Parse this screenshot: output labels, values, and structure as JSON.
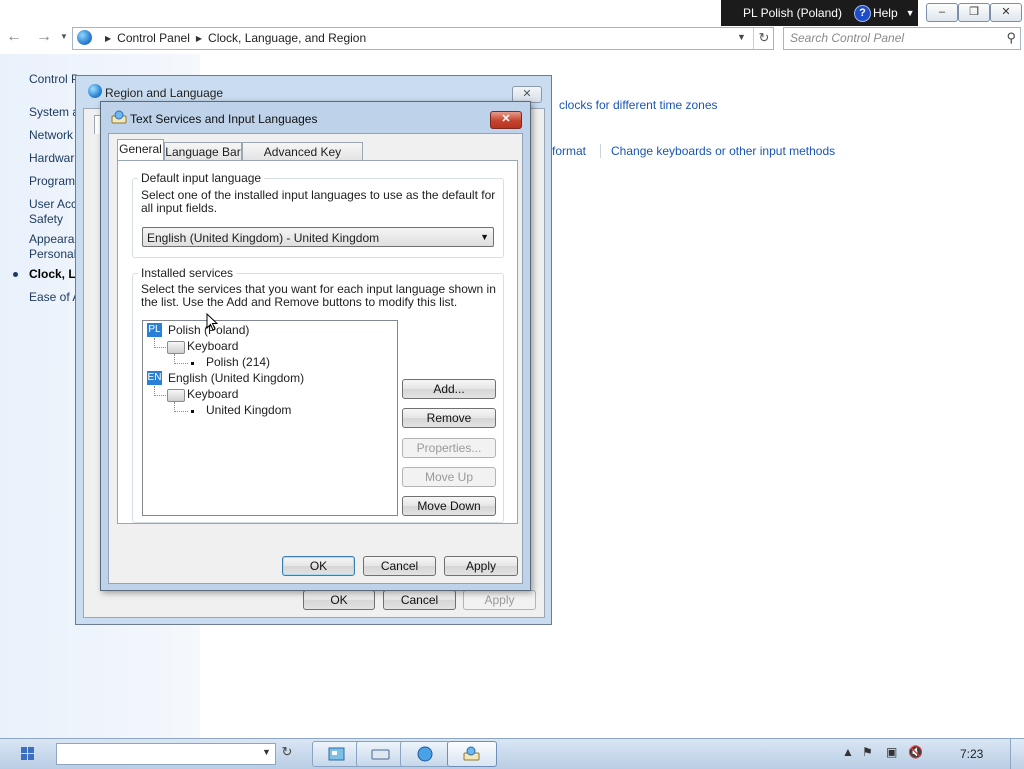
{
  "langbar": {
    "language": "PL Polish (Poland)",
    "help": "Help",
    "help_icon": "?"
  },
  "window_controls": {
    "minimize": "–",
    "restore": "❐",
    "close": "✕"
  },
  "address": {
    "breadcrumbs": [
      "Control Panel",
      "Clock, Language, and Region"
    ],
    "search_placeholder": "Search Control Panel"
  },
  "left_pane": {
    "items": [
      "Control P",
      "System a",
      "Network",
      "Hardwar",
      "Program",
      "User Acc",
      "Safety",
      "Appearan",
      "Personal",
      "Clock, La",
      "Ease of A"
    ]
  },
  "right_links": {
    "clocks": "clocks for different time zones",
    "format": "format",
    "keyboards": "Change keyboards or other input methods"
  },
  "region_dialog": {
    "title": "Region and Language",
    "ok": "OK",
    "cancel": "Cancel",
    "apply": "Apply"
  },
  "ts_dialog": {
    "title": "Text Services and Input Languages",
    "tabs": [
      "General",
      "Language Bar",
      "Advanced Key Settings"
    ],
    "default_group": {
      "label": "Default input language",
      "description": "Select one of the installed input languages to use as the default for all input fields.",
      "selected": "English (United Kingdom) - United Kingdom"
    },
    "installed_group": {
      "label": "Installed services",
      "description": "Select the services that you want for each input language shown in the list. Use the Add and Remove buttons to modify this list."
    },
    "tree": [
      {
        "flag": "PL",
        "language": "Polish (Poland)",
        "type": "Keyboard",
        "layout": "Polish (214)"
      },
      {
        "flag": "EN",
        "language": "English (United Kingdom)",
        "type": "Keyboard",
        "layout": "United Kingdom"
      }
    ],
    "buttons": {
      "add": "Add...",
      "remove": "Remove",
      "properties": "Properties...",
      "move_up": "Move Up",
      "move_down": "Move Down",
      "ok": "OK",
      "cancel": "Cancel",
      "apply": "Apply"
    }
  },
  "taskbar": {
    "clock": "7:23"
  }
}
